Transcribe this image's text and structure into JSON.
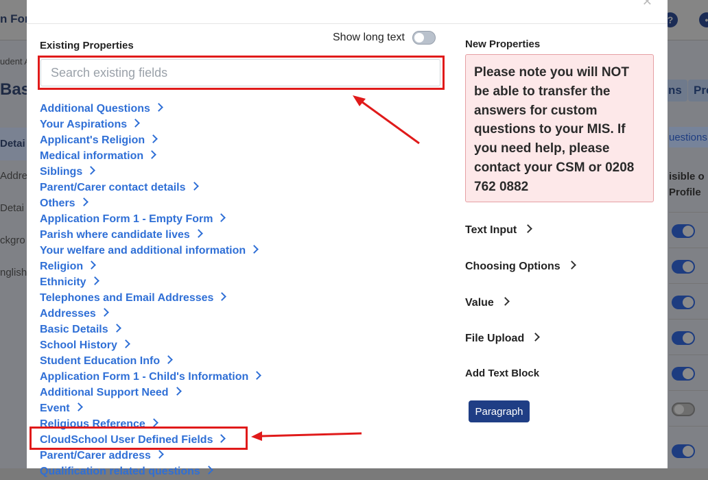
{
  "background": {
    "header_fragment": "n Forn",
    "breadcrumb_fragment": "udent A",
    "page_title_fragment": "Basi",
    "left_fragments": [
      "Detai",
      "Addre",
      "Detai",
      "ckgro",
      "nglish"
    ],
    "tab_fragments": [
      "ns",
      "Pre"
    ],
    "questions_fragment": "uestions",
    "column_header_line1": "isible o",
    "column_header_line2": "Profile"
  },
  "modal": {
    "existing_title": "Existing Properties",
    "long_text_label": "Show long text",
    "long_text_on": false,
    "search_placeholder": "Search existing fields",
    "search_value": "",
    "fields": [
      "Additional Questions",
      "Your Aspirations",
      "Applicant's Religion",
      "Medical information",
      "Siblings",
      "Parent/Carer contact details",
      "Others",
      "Application Form 1 - Empty Form",
      "Parish where candidate lives",
      "Your welfare and additional information",
      "Religion",
      "Ethnicity",
      "Telephones and Email Addresses",
      "Addresses",
      "Basic Details",
      "School History",
      "Student Education Info",
      "Application Form 1 - Child's Information",
      "Additional Support Need",
      "Event",
      "Religious Reference",
      "CloudSchool User Defined Fields",
      "Parent/Carer address",
      "Qualification related questions"
    ],
    "new_title": "New Properties",
    "note": "Please note you will NOT be able to transfer the answers for custom questions to your MIS. If you need help, please contact your CSM or 0208 762 0882",
    "properties": [
      "Text Input",
      "Choosing Options",
      "Value",
      "File Upload"
    ],
    "text_block_title": "Add Text Block",
    "paragraph_button": "Paragraph"
  },
  "colors": {
    "link": "#2f6fd6",
    "annotation": "#e01a1a",
    "primary_button": "#1f3e85",
    "note_bg": "#fde8e9"
  }
}
